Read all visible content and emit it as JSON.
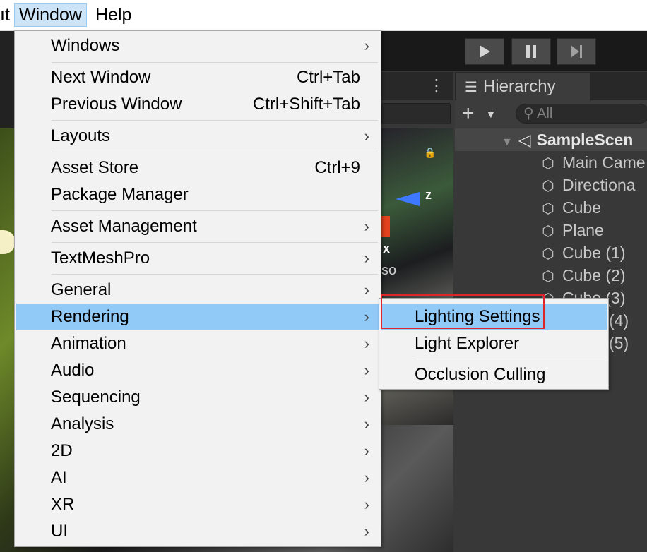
{
  "menubar": {
    "prev_partial": "ıt",
    "window": "Window",
    "help": "Help"
  },
  "window_menu": {
    "items": [
      {
        "label": "Windows",
        "submenu": true
      },
      {
        "label": "Next Window",
        "shortcut": "Ctrl+Tab"
      },
      {
        "label": "Previous Window",
        "shortcut": "Ctrl+Shift+Tab"
      },
      {
        "label": "Layouts",
        "submenu": true
      },
      {
        "label": "Asset Store",
        "shortcut": "Ctrl+9"
      },
      {
        "label": "Package Manager"
      },
      {
        "label": "Asset Management",
        "submenu": true
      },
      {
        "label": "TextMeshPro",
        "submenu": true
      },
      {
        "label": "General",
        "submenu": true
      },
      {
        "label": "Rendering",
        "submenu": true,
        "highlighted": true
      },
      {
        "label": "Animation",
        "submenu": true
      },
      {
        "label": "Audio",
        "submenu": true
      },
      {
        "label": "Sequencing",
        "submenu": true
      },
      {
        "label": "Analysis",
        "submenu": true
      },
      {
        "label": "2D",
        "submenu": true
      },
      {
        "label": "AI",
        "submenu": true
      },
      {
        "label": "XR",
        "submenu": true
      },
      {
        "label": "UI",
        "submenu": true
      }
    ],
    "arrow_glyph": "›"
  },
  "rendering_submenu": {
    "items": [
      {
        "label": "Lighting Settings",
        "highlighted": true
      },
      {
        "label": "Light Explorer"
      },
      {
        "label": "Occlusion Culling"
      }
    ]
  },
  "hierarchy": {
    "tab_label": "Hierarchy",
    "search_placeholder": "All",
    "scene": "SampleScen",
    "items": [
      "Main Came",
      "Directiona",
      "Cube",
      "Plane",
      "Cube (1)",
      "Cube (2)",
      "Cube (3)",
      "(4)",
      "(5)"
    ]
  },
  "scene_view": {
    "axis_z": "z",
    "axis_x": "x",
    "projection_partial": "so"
  },
  "toolbar": {
    "play_icon": "play-icon",
    "pause_icon": "pause-icon",
    "step_icon": "step-icon"
  },
  "colors": {
    "highlight": "#91c9f7",
    "annotation_box": "#e0242b",
    "editor_bg": "#383838"
  }
}
